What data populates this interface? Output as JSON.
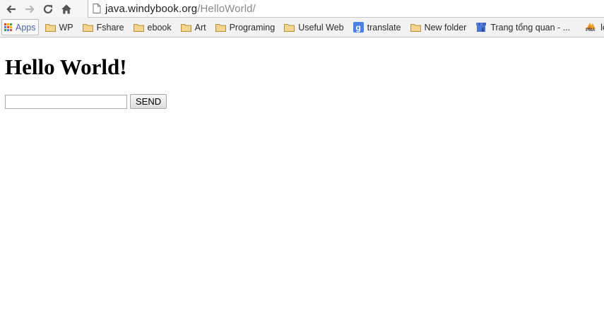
{
  "browser": {
    "url_host": "java.windybook.org",
    "url_path": "/HelloWorld/"
  },
  "bookmarks": {
    "apps_label": "Apps",
    "items": [
      {
        "label": "WP",
        "icon": "folder-icon"
      },
      {
        "label": "Fshare",
        "icon": "folder-icon"
      },
      {
        "label": "ebook",
        "icon": "folder-icon"
      },
      {
        "label": "Art",
        "icon": "folder-icon"
      },
      {
        "label": "Programing",
        "icon": "folder-icon"
      },
      {
        "label": "Useful Web",
        "icon": "folder-icon"
      },
      {
        "label": "translate",
        "icon": "google-translate-icon"
      },
      {
        "label": "New folder",
        "icon": "folder-icon"
      },
      {
        "label": "Trang tổng quan - ...",
        "icon": "store-icon"
      },
      {
        "label": "loca",
        "icon": "pma-icon"
      }
    ],
    "pma_icon_text": "PMA"
  },
  "page": {
    "heading": "Hello World!",
    "input_value": "",
    "send_label": "SEND"
  },
  "colors": {
    "folder": "#e8c272",
    "translate_icon": "#4a82e8",
    "apps_label": "#4a64a8"
  }
}
